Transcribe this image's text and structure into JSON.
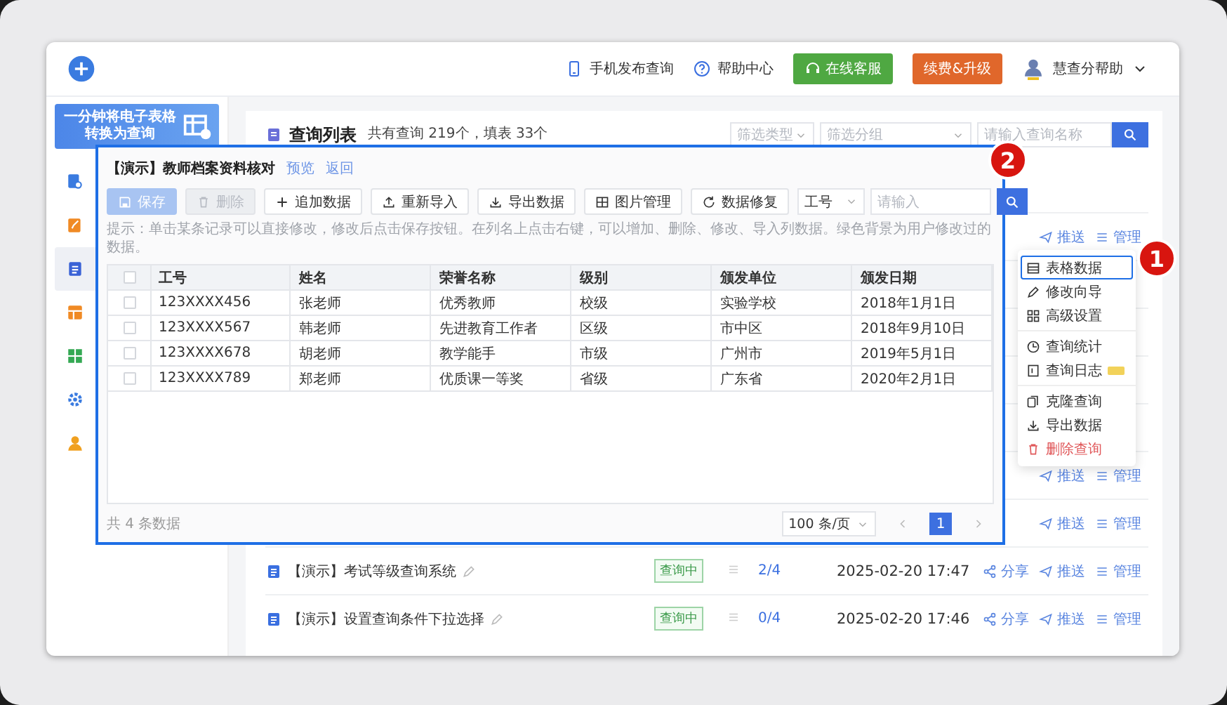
{
  "header": {
    "links": [
      {
        "kind": "phone",
        "label": "手机发布查询"
      },
      {
        "kind": "help",
        "label": "帮助中心"
      }
    ],
    "buttons": [
      {
        "label": "在线客服",
        "color": "#4fa842"
      },
      {
        "label": "续费&升级",
        "color": "#e0672b"
      }
    ],
    "user": {
      "name": "慧查分帮助"
    }
  },
  "sidebar": {
    "banner": [
      "一分钟将电子表格",
      "转换为查询"
    ],
    "items": [
      {
        "kind": "publish",
        "selected": false
      },
      {
        "kind": "create",
        "selected": false
      },
      {
        "kind": "list",
        "selected": true
      },
      {
        "kind": "template",
        "selected": false
      },
      {
        "kind": "tools",
        "selected": false
      },
      {
        "kind": "system",
        "selected": false
      },
      {
        "kind": "account",
        "selected": false
      }
    ]
  },
  "list": {
    "title": "查询列表",
    "summary": "共有查询 219个，填表 33个",
    "filters": [
      {
        "placeholder": "筛选类型"
      },
      {
        "placeholder": "筛选分组"
      }
    ],
    "search": {
      "placeholder": "请输入查询名称"
    },
    "rows": [
      {
        "kind": "covered",
        "actions": [
          "推送",
          "管理"
        ]
      },
      {
        "kind": "covered"
      },
      {
        "kind": "covered"
      },
      {
        "kind": "covered"
      },
      {
        "kind": "covered"
      },
      {
        "kind": "covered",
        "actions": [
          "推送",
          "管理"
        ]
      },
      {
        "kind": "covered",
        "actions": [
          "推送",
          "管理"
        ]
      },
      {
        "kind": "full",
        "title": "【演示】考试等级查询系统",
        "status": "查询中",
        "progress": "2/4",
        "date": "2025-02-20 17:47",
        "actions": [
          "分享",
          "推送",
          "管理"
        ]
      },
      {
        "kind": "full",
        "title": "【演示】设置查询条件下拉选择",
        "status": "查询中",
        "progress": "0/4",
        "date": "2025-02-20 17:46",
        "actions": [
          "分享",
          "推送",
          "管理"
        ]
      }
    ]
  },
  "modal": {
    "title": "【演示】教师档案资料核对",
    "links": [
      "预览",
      "返回"
    ],
    "toolbar": [
      {
        "kind": "save",
        "label": "保存",
        "disabled": true
      },
      {
        "kind": "delete",
        "label": "删除",
        "disabled": true
      },
      {
        "kind": "add",
        "label": "追加数据",
        "disabled": false
      },
      {
        "kind": "import",
        "label": "重新导入",
        "disabled": false
      },
      {
        "kind": "export",
        "label": "导出数据",
        "disabled": false
      },
      {
        "kind": "image",
        "label": "图片管理",
        "disabled": false
      },
      {
        "kind": "repair",
        "label": "数据修复",
        "disabled": false
      }
    ],
    "field_select": "工号",
    "search": {
      "placeholder": "请输入"
    },
    "hint": "提示：单击某条记录可以直接修改，修改后点击保存按钮。在列名上点击右键，可以增加、删除、修改、导入列数据。绿色背景为用户修改过的数据。",
    "table": {
      "all_checked": false,
      "columns": [
        "工号",
        "姓名",
        "荣誉名称",
        "级别",
        "颁发单位",
        "颁发日期"
      ],
      "rows": [
        {
          "checked": false,
          "cells": [
            "123XXXX456",
            "张老师",
            "优秀教师",
            "校级",
            "实验学校",
            "2018年1月1日"
          ]
        },
        {
          "checked": false,
          "cells": [
            "123XXXX567",
            "韩老师",
            "先进教育工作者",
            "区级",
            "市中区",
            "2018年9月10日"
          ]
        },
        {
          "checked": false,
          "cells": [
            "123XXXX678",
            "胡老师",
            "教学能手",
            "市级",
            "广州市",
            "2019年5月1日"
          ]
        },
        {
          "checked": false,
          "cells": [
            "123XXXX789",
            "郑老师",
            "优质课一等奖",
            "省级",
            "广东省",
            "2020年2月1日"
          ]
        }
      ]
    },
    "footer": {
      "count": "共 4 条数据",
      "page_size": "100 条/页",
      "pages": [
        {
          "label": "1",
          "selected": true
        }
      ]
    }
  },
  "menu": {
    "groups": [
      [
        {
          "kind": "table",
          "label": "表格数据",
          "selected": true,
          "tagged": false
        },
        {
          "kind": "edit",
          "label": "修改向导",
          "selected": false,
          "tagged": false
        },
        {
          "kind": "settings",
          "label": "高级设置",
          "selected": false,
          "tagged": false
        }
      ],
      [
        {
          "kind": "stats",
          "label": "查询统计",
          "selected": false,
          "tagged": false
        },
        {
          "kind": "log",
          "label": "查询日志",
          "selected": false,
          "tagged": true
        }
      ],
      [
        {
          "kind": "clone",
          "label": "克隆查询",
          "selected": false,
          "tagged": false
        },
        {
          "kind": "export",
          "label": "导出数据",
          "selected": false,
          "tagged": false
        },
        {
          "kind": "delete",
          "label": "删除查询",
          "selected": false,
          "tagged": false
        }
      ]
    ]
  },
  "markers": [
    {
      "label": "1"
    },
    {
      "label": "2"
    }
  ]
}
